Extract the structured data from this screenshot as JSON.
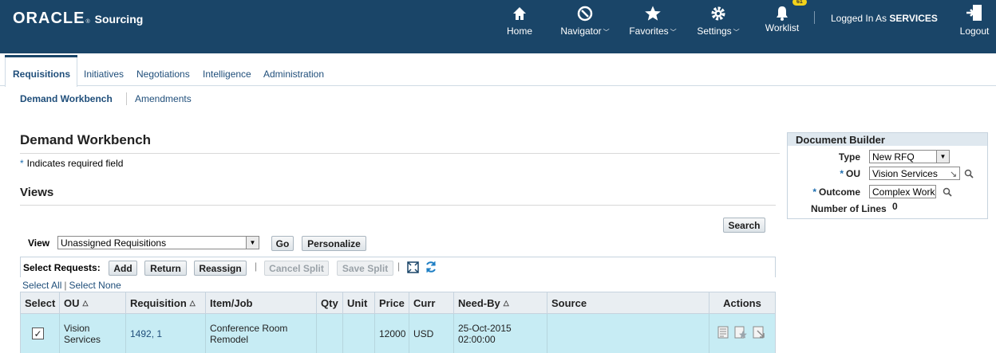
{
  "header": {
    "brand": "ORACLE",
    "app_name": "Sourcing",
    "nav": [
      {
        "label": "Home",
        "icon": "home-icon"
      },
      {
        "label": "Navigator",
        "icon": "compass-icon"
      },
      {
        "label": "Favorites",
        "icon": "star-icon"
      },
      {
        "label": "Settings",
        "icon": "gear-icon"
      },
      {
        "label": "Worklist",
        "icon": "bell-icon"
      },
      {
        "label": "Logout",
        "icon": "logout-icon"
      }
    ],
    "worklist_badge": "61",
    "logged_in_prefix": "Logged In As",
    "logged_in_user": "SERVICES",
    "colors": {
      "header_bg": "#1a4568",
      "badge": "#f2d21a"
    }
  },
  "tabs": [
    "Requisitions",
    "Initiatives",
    "Negotiations",
    "Intelligence",
    "Administration"
  ],
  "subtabs": [
    "Demand Workbench",
    "Amendments"
  ],
  "page": {
    "title": "Demand Workbench",
    "required_note": "Indicates required field",
    "required_marker": "*",
    "views_title": "Views"
  },
  "view_bar": {
    "search_label": "Search",
    "view_label": "View",
    "view_value": "Unassigned Requisitions",
    "go_label": "Go",
    "personalize_label": "Personalize"
  },
  "toolbar": {
    "select_requests_label": "Select Requests:",
    "add": "Add",
    "return": "Return",
    "reassign": "Reassign",
    "cancel_split": "Cancel Split",
    "save_split": "Save Split",
    "pipe": "|",
    "select_all": "Select All",
    "select_none": "Select None",
    "separator": "|"
  },
  "table": {
    "columns": [
      "Select",
      "OU",
      "Requisition",
      "Item/Job",
      "Qty",
      "Unit",
      "Price",
      "Curr",
      "Need-By",
      "Source",
      "Actions"
    ],
    "rows": [
      {
        "selected": true,
        "check_glyph": "✓",
        "ou_line1": "Vision",
        "ou_line2": "Services",
        "requisition": "1492, 1",
        "item_line1": "Conference Room",
        "item_line2": "Remodel",
        "qty": "",
        "unit": "",
        "price": "12000",
        "curr": "USD",
        "need_by_line1": "25-Oct-2015",
        "need_by_line2": "02:00:00",
        "source": ""
      }
    ],
    "row_color": "#c7ecf4"
  },
  "document_builder": {
    "title": "Document Builder",
    "type_label": "Type",
    "type_value": "New RFQ",
    "ou_label": "OU",
    "ou_value": "Vision Services",
    "outcome_label": "Outcome",
    "outcome_value": "Complex Work",
    "lines_label": "Number of Lines",
    "lines_value": "0"
  }
}
